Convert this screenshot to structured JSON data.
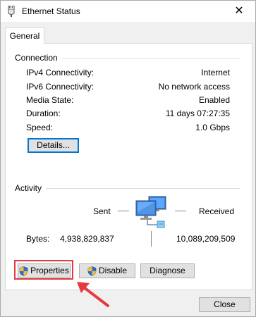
{
  "window": {
    "title": "Ethernet Status",
    "close_glyph": "✕",
    "title_icon": "network-adapter-icon"
  },
  "tabs": [
    {
      "label": "General",
      "selected": true
    }
  ],
  "connection": {
    "heading": "Connection",
    "rows": [
      {
        "label": "IPv4 Connectivity:",
        "value": "Internet"
      },
      {
        "label": "IPv6 Connectivity:",
        "value": "No network access"
      },
      {
        "label": "Media State:",
        "value": "Enabled"
      },
      {
        "label": "Duration:",
        "value": "11 days 07:27:35"
      },
      {
        "label": "Speed:",
        "value": "1.0 Gbps"
      }
    ],
    "details_label": "Details..."
  },
  "activity": {
    "heading": "Activity",
    "sent_label": "Sent",
    "received_label": "Received",
    "bytes_label": "Bytes:",
    "bytes_sent": "4,938,829,837",
    "bytes_received": "10,089,209,509",
    "icon": "network-computers-icon"
  },
  "actions": {
    "properties_label": "Properties",
    "disable_label": "Disable",
    "diagnose_label": "Diagnose",
    "shield_icon": "uac-shield-icon"
  },
  "footer": {
    "close_label": "Close"
  },
  "annotation": {
    "highlight_color": "#e53a40",
    "arrow_color": "#e53a40"
  },
  "colors": {
    "focus_border": "#0078d7",
    "button_face": "#e1e1e1",
    "dialog_bg": "#f0f0f0"
  }
}
